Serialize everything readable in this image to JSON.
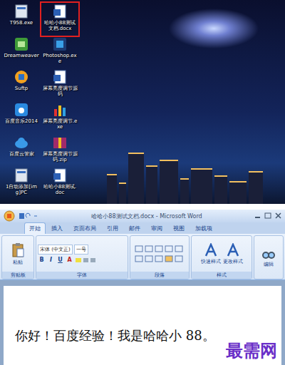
{
  "desktop": {
    "icons": [
      {
        "label": "T958.exe",
        "selected": false,
        "kind": "exe"
      },
      {
        "label": "哈哈小88测试文档.docx",
        "selected": true,
        "kind": "doc"
      },
      {
        "label": "Dreamweaver",
        "selected": false,
        "kind": "dw"
      },
      {
        "label": "Photoshop.exe",
        "selected": false,
        "kind": "ps"
      },
      {
        "label": "Suftp",
        "selected": false,
        "kind": "ftp"
      },
      {
        "label": "屏幕亮度调节源码",
        "selected": false,
        "kind": "doc"
      },
      {
        "label": "百度音乐2014",
        "selected": false,
        "kind": "music"
      },
      {
        "label": "屏幕亮度调节.exe",
        "selected": false,
        "kind": "chart"
      },
      {
        "label": "百度云管家",
        "selected": false,
        "kind": "cloud"
      },
      {
        "label": "屏幕亮度调节源码.zip",
        "selected": false,
        "kind": "zip"
      },
      {
        "label": "1自动添加[img]PC",
        "selected": false,
        "kind": "exe"
      },
      {
        "label": "哈哈小88测试.doc",
        "selected": false,
        "kind": "doc"
      }
    ]
  },
  "word": {
    "title": "哈哈小88测试文档.docx - Microsoft Word",
    "tabs": [
      {
        "label": "开始",
        "selected": true
      },
      {
        "label": "插入",
        "selected": false
      },
      {
        "label": "页面布局",
        "selected": false
      },
      {
        "label": "引用",
        "selected": false
      },
      {
        "label": "邮件",
        "selected": false
      },
      {
        "label": "审阅",
        "selected": false
      },
      {
        "label": "视图",
        "selected": false
      },
      {
        "label": "加载项",
        "selected": false
      }
    ],
    "ribbon": {
      "paste": "粘贴",
      "font_name": "宋体 (中文正)",
      "font_size": "一号",
      "format_buttons": [
        "B",
        "I",
        "U",
        "A"
      ],
      "quick_styles": "快速样式",
      "change_styles": "更改样式",
      "editing": "编辑",
      "groups": [
        "剪贴板",
        "字体",
        "段落",
        "样式"
      ]
    },
    "document": {
      "text": "你好！百度经验！我是哈哈小 88。"
    }
  },
  "watermark": "最需网"
}
